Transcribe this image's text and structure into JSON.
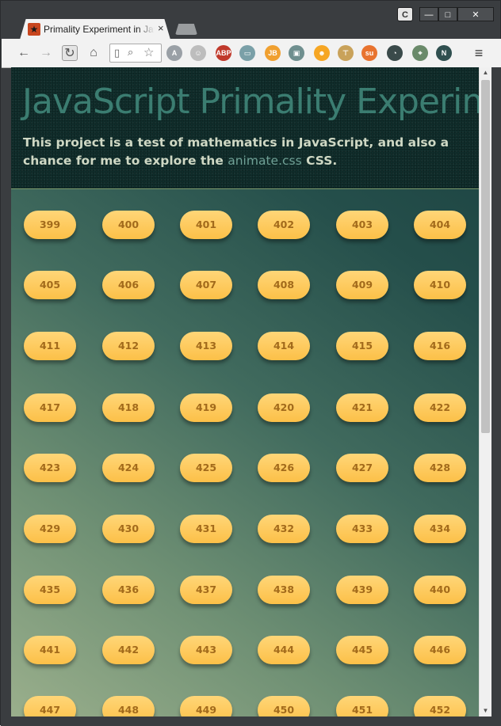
{
  "browser": {
    "tab_title": "Primality Experiment in JavaScript",
    "tab_close": "×",
    "profile_button": "C",
    "window_minimize": "—",
    "window_maximize": "□",
    "window_close": "✕",
    "extensions": [
      {
        "name": "angularjs-batarang-icon",
        "label": "A",
        "color": "#9aa0a6"
      },
      {
        "name": "ghost-extension-icon",
        "label": "☺",
        "color": "#bdbdbd"
      },
      {
        "name": "adblock-plus-icon",
        "label": "ABP",
        "color": "#c0392b"
      },
      {
        "name": "window-resizer-icon",
        "label": "▭",
        "color": "#7aa0a8"
      },
      {
        "name": "jetbrains-icon",
        "label": "JB",
        "color": "#f0a030"
      },
      {
        "name": "screen-capture-icon",
        "label": "▣",
        "color": "#6f8f8f"
      },
      {
        "name": "emoji-face-icon",
        "label": "☻",
        "color": "#f6a623"
      },
      {
        "name": "ruler-icon",
        "label": "⊤",
        "color": "#c9a25a"
      },
      {
        "name": "stumbleupon-icon",
        "label": "su",
        "color": "#e8732f"
      },
      {
        "name": "speedometer-icon",
        "label": "◔",
        "color": "#3a4a4a"
      },
      {
        "name": "eyedropper-icon",
        "label": "⌖",
        "color": "#6a8a6a"
      },
      {
        "name": "new-note-icon",
        "label": "N",
        "color": "#2f4f4f"
      }
    ]
  },
  "page": {
    "title": "JavaScript Primality Experiment",
    "intro_before": "This project is a test of mathematics in JavaScript, and also a chance for me to explore the ",
    "intro_link": "animate.css",
    "intro_after": " CSS."
  },
  "numbers": [
    399,
    400,
    401,
    402,
    403,
    404,
    405,
    406,
    407,
    408,
    409,
    410,
    411,
    412,
    413,
    414,
    415,
    416,
    417,
    418,
    419,
    420,
    421,
    422,
    423,
    424,
    425,
    426,
    427,
    428,
    429,
    430,
    431,
    432,
    433,
    434,
    435,
    436,
    437,
    438,
    439,
    440,
    441,
    442,
    443,
    444,
    445,
    446,
    447,
    448,
    449,
    450,
    451,
    452
  ]
}
